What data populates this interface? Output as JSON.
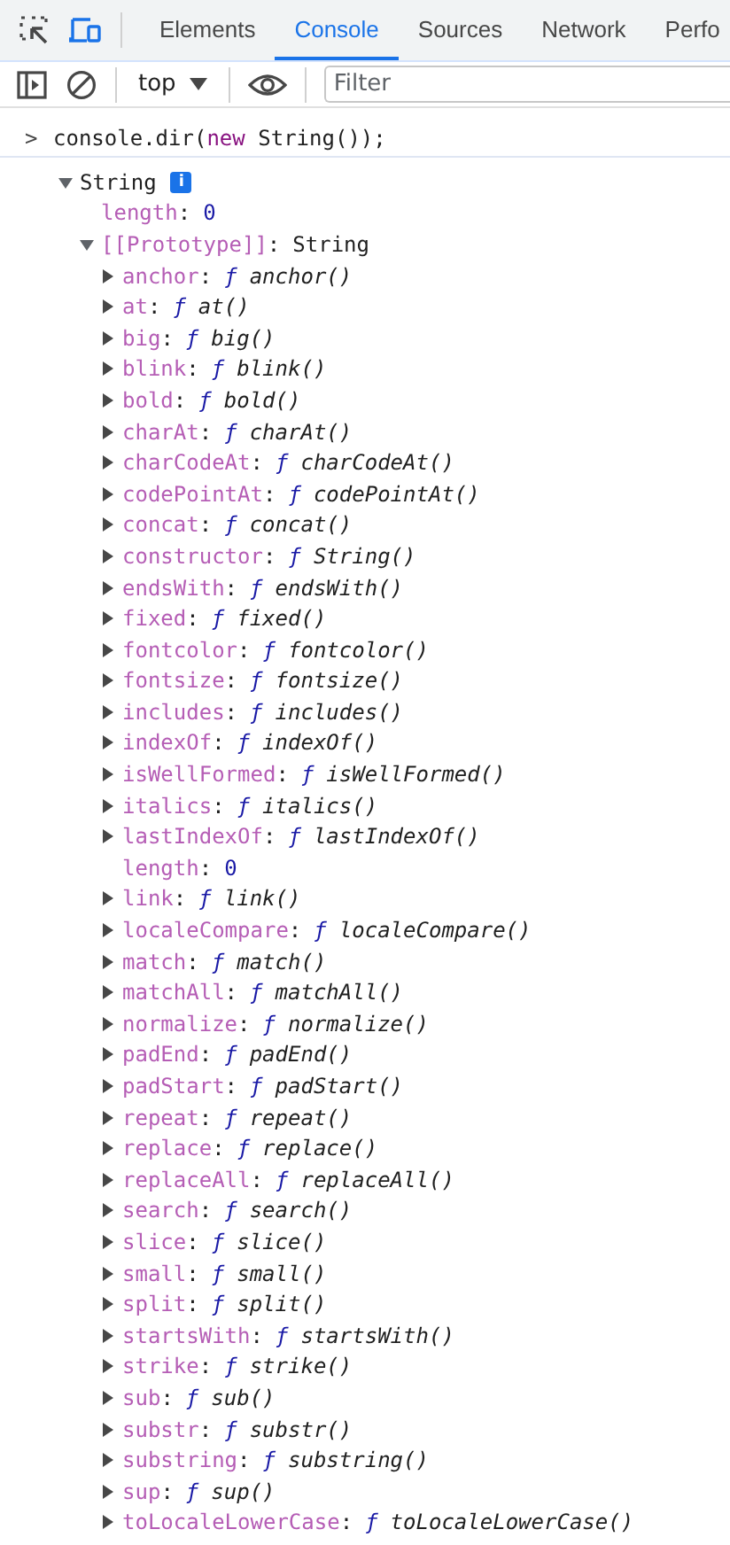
{
  "tabs": [
    {
      "label": "Elements",
      "selected": false
    },
    {
      "label": "Console",
      "selected": true
    },
    {
      "label": "Sources",
      "selected": false
    },
    {
      "label": "Network",
      "selected": false
    },
    {
      "label": "Perfo",
      "selected": false
    }
  ],
  "toolbar": {
    "context": "top",
    "filter": {
      "placeholder": "Filter"
    }
  },
  "console": {
    "prompt": ">",
    "input": [
      {
        "kind": "plain",
        "text": "console.dir("
      },
      {
        "kind": "keyword",
        "text": "new"
      },
      {
        "kind": "plain",
        "text": " String());"
      }
    ],
    "output": {
      "label": "String",
      "badge": "i",
      "expanded": true,
      "children": [
        {
          "kind": "number",
          "key": "length:",
          "value": "0"
        },
        {
          "kind": "object",
          "key": "[[Prototype]]:",
          "value": "String",
          "expanded": true,
          "children": [
            {
              "kind": "function",
              "key": "anchor:",
              "marker": "ƒ",
              "value": "anchor()",
              "expanded": false
            },
            {
              "kind": "function",
              "key": "at:",
              "marker": "ƒ",
              "value": "at()",
              "expanded": false
            },
            {
              "kind": "function",
              "key": "big:",
              "marker": "ƒ",
              "value": "big()",
              "expanded": false
            },
            {
              "kind": "function",
              "key": "blink:",
              "marker": "ƒ",
              "value": "blink()",
              "expanded": false
            },
            {
              "kind": "function",
              "key": "bold:",
              "marker": "ƒ",
              "value": "bold()",
              "expanded": false
            },
            {
              "kind": "function",
              "key": "charAt:",
              "marker": "ƒ",
              "value": "charAt()",
              "expanded": false
            },
            {
              "kind": "function",
              "key": "charCodeAt:",
              "marker": "ƒ",
              "value": "charCodeAt()",
              "expanded": false
            },
            {
              "kind": "function",
              "key": "codePointAt:",
              "marker": "ƒ",
              "value": "codePointAt()",
              "expanded": false
            },
            {
              "kind": "function",
              "key": "concat:",
              "marker": "ƒ",
              "value": "concat()",
              "expanded": false
            },
            {
              "kind": "function",
              "key": "constructor:",
              "marker": "ƒ",
              "value": "String()",
              "expanded": false
            },
            {
              "kind": "function",
              "key": "endsWith:",
              "marker": "ƒ",
              "value": "endsWith()",
              "expanded": false
            },
            {
              "kind": "function",
              "key": "fixed:",
              "marker": "ƒ",
              "value": "fixed()",
              "expanded": false
            },
            {
              "kind": "function",
              "key": "fontcolor:",
              "marker": "ƒ",
              "value": "fontcolor()",
              "expanded": false
            },
            {
              "kind": "function",
              "key": "fontsize:",
              "marker": "ƒ",
              "value": "fontsize()",
              "expanded": false
            },
            {
              "kind": "function",
              "key": "includes:",
              "marker": "ƒ",
              "value": "includes()",
              "expanded": false
            },
            {
              "kind": "function",
              "key": "indexOf:",
              "marker": "ƒ",
              "value": "indexOf()",
              "expanded": false
            },
            {
              "kind": "function",
              "key": "isWellFormed:",
              "marker": "ƒ",
              "value": "isWellFormed()",
              "expanded": false
            },
            {
              "kind": "function",
              "key": "italics:",
              "marker": "ƒ",
              "value": "italics()",
              "expanded": false
            },
            {
              "kind": "function",
              "key": "lastIndexOf:",
              "marker": "ƒ",
              "value": "lastIndexOf()",
              "expanded": false
            },
            {
              "kind": "number",
              "key": "length:",
              "value": "0"
            },
            {
              "kind": "function",
              "key": "link:",
              "marker": "ƒ",
              "value": "link()",
              "expanded": false
            },
            {
              "kind": "function",
              "key": "localeCompare:",
              "marker": "ƒ",
              "value": "localeCompare()",
              "expanded": false
            },
            {
              "kind": "function",
              "key": "match:",
              "marker": "ƒ",
              "value": "match()",
              "expanded": false
            },
            {
              "kind": "function",
              "key": "matchAll:",
              "marker": "ƒ",
              "value": "matchAll()",
              "expanded": false
            },
            {
              "kind": "function",
              "key": "normalize:",
              "marker": "ƒ",
              "value": "normalize()",
              "expanded": false
            },
            {
              "kind": "function",
              "key": "padEnd:",
              "marker": "ƒ",
              "value": "padEnd()",
              "expanded": false
            },
            {
              "kind": "function",
              "key": "padStart:",
              "marker": "ƒ",
              "value": "padStart()",
              "expanded": false
            },
            {
              "kind": "function",
              "key": "repeat:",
              "marker": "ƒ",
              "value": "repeat()",
              "expanded": false
            },
            {
              "kind": "function",
              "key": "replace:",
              "marker": "ƒ",
              "value": "replace()",
              "expanded": false
            },
            {
              "kind": "function",
              "key": "replaceAll:",
              "marker": "ƒ",
              "value": "replaceAll()",
              "expanded": false
            },
            {
              "kind": "function",
              "key": "search:",
              "marker": "ƒ",
              "value": "search()",
              "expanded": false
            },
            {
              "kind": "function",
              "key": "slice:",
              "marker": "ƒ",
              "value": "slice()",
              "expanded": false
            },
            {
              "kind": "function",
              "key": "small:",
              "marker": "ƒ",
              "value": "small()",
              "expanded": false
            },
            {
              "kind": "function",
              "key": "split:",
              "marker": "ƒ",
              "value": "split()",
              "expanded": false
            },
            {
              "kind": "function",
              "key": "startsWith:",
              "marker": "ƒ",
              "value": "startsWith()",
              "expanded": false
            },
            {
              "kind": "function",
              "key": "strike:",
              "marker": "ƒ",
              "value": "strike()",
              "expanded": false
            },
            {
              "kind": "function",
              "key": "sub:",
              "marker": "ƒ",
              "value": "sub()",
              "expanded": false
            },
            {
              "kind": "function",
              "key": "substr:",
              "marker": "ƒ",
              "value": "substr()",
              "expanded": false
            },
            {
              "kind": "function",
              "key": "substring:",
              "marker": "ƒ",
              "value": "substring()",
              "expanded": false
            },
            {
              "kind": "function",
              "key": "sup:",
              "marker": "ƒ",
              "value": "sup()",
              "expanded": false
            },
            {
              "kind": "function",
              "key": "toLocaleLowerCase:",
              "marker": "ƒ",
              "value": "toLocaleLowerCase()",
              "expanded": false
            }
          ]
        }
      ]
    }
  }
}
